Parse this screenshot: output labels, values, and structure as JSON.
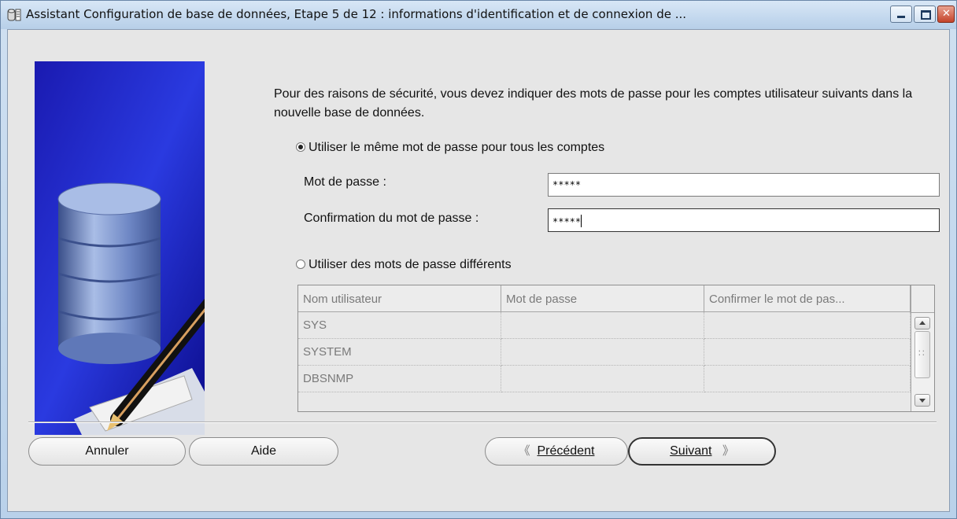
{
  "window": {
    "title": "Assistant Configuration de base de données, Etape 5 de 12 : informations d'identification et de connexion de ...",
    "icon": "database-app-icon"
  },
  "content": {
    "intro": "Pour des raisons de sécurité, vous devez indiquer des mots de passe pour les comptes utilisateur suivants dans la nouvelle base de données.",
    "option_same": "Utiliser le même mot de passe pour tous les comptes",
    "option_different": "Utiliser des mots de passe différents",
    "option_same_selected": true,
    "password_label": "Mot de passe :",
    "password_value": "*****",
    "confirm_label": "Confirmation du mot de passe :",
    "confirm_value": "*****"
  },
  "table": {
    "headers": [
      "Nom utilisateur",
      "Mot de passe",
      "Confirmer le mot de pas..."
    ],
    "rows": [
      [
        "SYS",
        "",
        ""
      ],
      [
        "SYSTEM",
        "",
        ""
      ],
      [
        "DBSNMP",
        "",
        ""
      ]
    ]
  },
  "buttons": {
    "cancel": "Annuler",
    "help": "Aide",
    "previous": "Précédent",
    "next": "Suivant"
  }
}
